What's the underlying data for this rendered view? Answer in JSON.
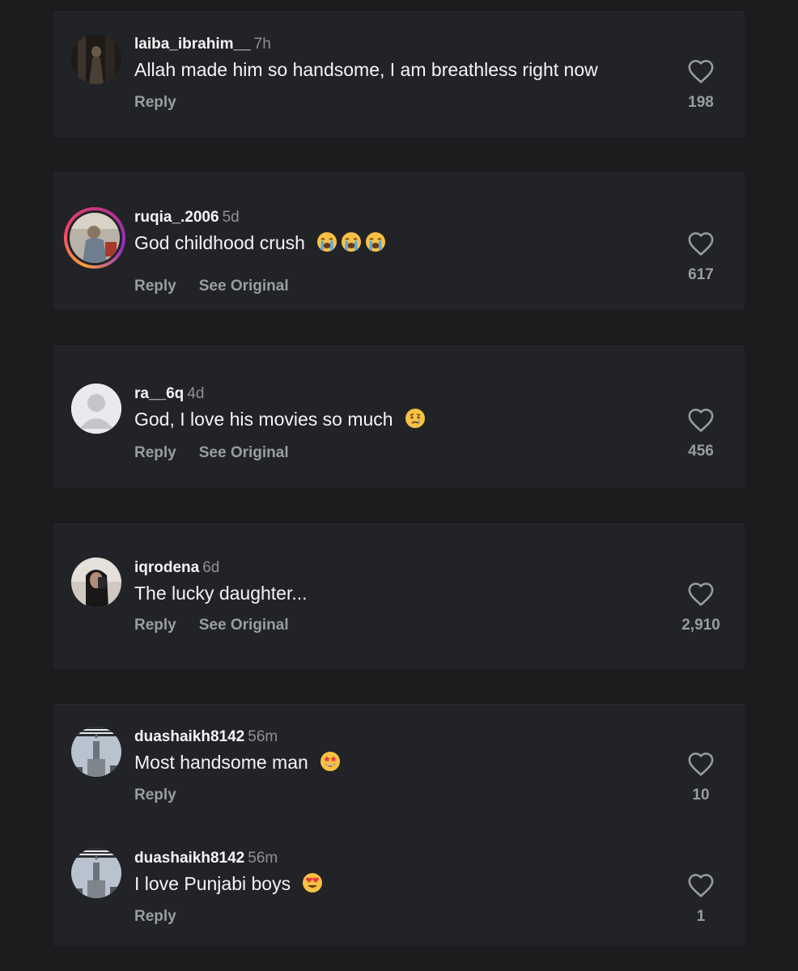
{
  "comments": [
    {
      "username": "laiba_ibrahim__",
      "time": "7h",
      "text": "Allah made him so handsome, I am breathless right now",
      "emojis": [],
      "reply": "Reply",
      "see_original": "",
      "likes": "198",
      "avatar": "avatar-photo-dark"
    },
    {
      "username": "ruqia_.2006",
      "time": "5d",
      "text": "God childhood crush",
      "emojis": [
        "loudly-crying-face",
        "loudly-crying-face",
        "loudly-crying-face"
      ],
      "reply": "Reply",
      "see_original": "See Original",
      "likes": "617",
      "avatar": "avatar-photo-story-ring"
    },
    {
      "username": "ra__6q",
      "time": "4d",
      "text": "God, I love his movies so much",
      "emojis": [
        "crying-face"
      ],
      "reply": "Reply",
      "see_original": "See Original",
      "likes": "456",
      "avatar": "default-avatar"
    },
    {
      "username": "iqrodena",
      "time": "6d",
      "text": "The lucky daughter...",
      "emojis": [],
      "reply": "Reply",
      "see_original": "See Original",
      "likes": "2,910",
      "avatar": "avatar-photo-selfie"
    },
    {
      "username": "duashaikh8142",
      "time": "56m",
      "text": "Most handsome man",
      "emojis": [
        "star-struck"
      ],
      "reply": "Reply",
      "see_original": "",
      "likes": "10",
      "avatar": "avatar-photo-tower"
    },
    {
      "username": "duashaikh8142",
      "time": "56m",
      "text": "I love Punjabi boys",
      "emojis": [
        "smiling-face-with-heart-eyes"
      ],
      "reply": "Reply",
      "see_original": "",
      "likes": "1",
      "avatar": "avatar-photo-tower"
    }
  ],
  "colors": {
    "page_bg": "#1b1c1e",
    "card_bg": "#222327",
    "text_primary": "#f4f4f5",
    "text_secondary": "#9a9ca3",
    "story_ring": "#e1306c"
  }
}
